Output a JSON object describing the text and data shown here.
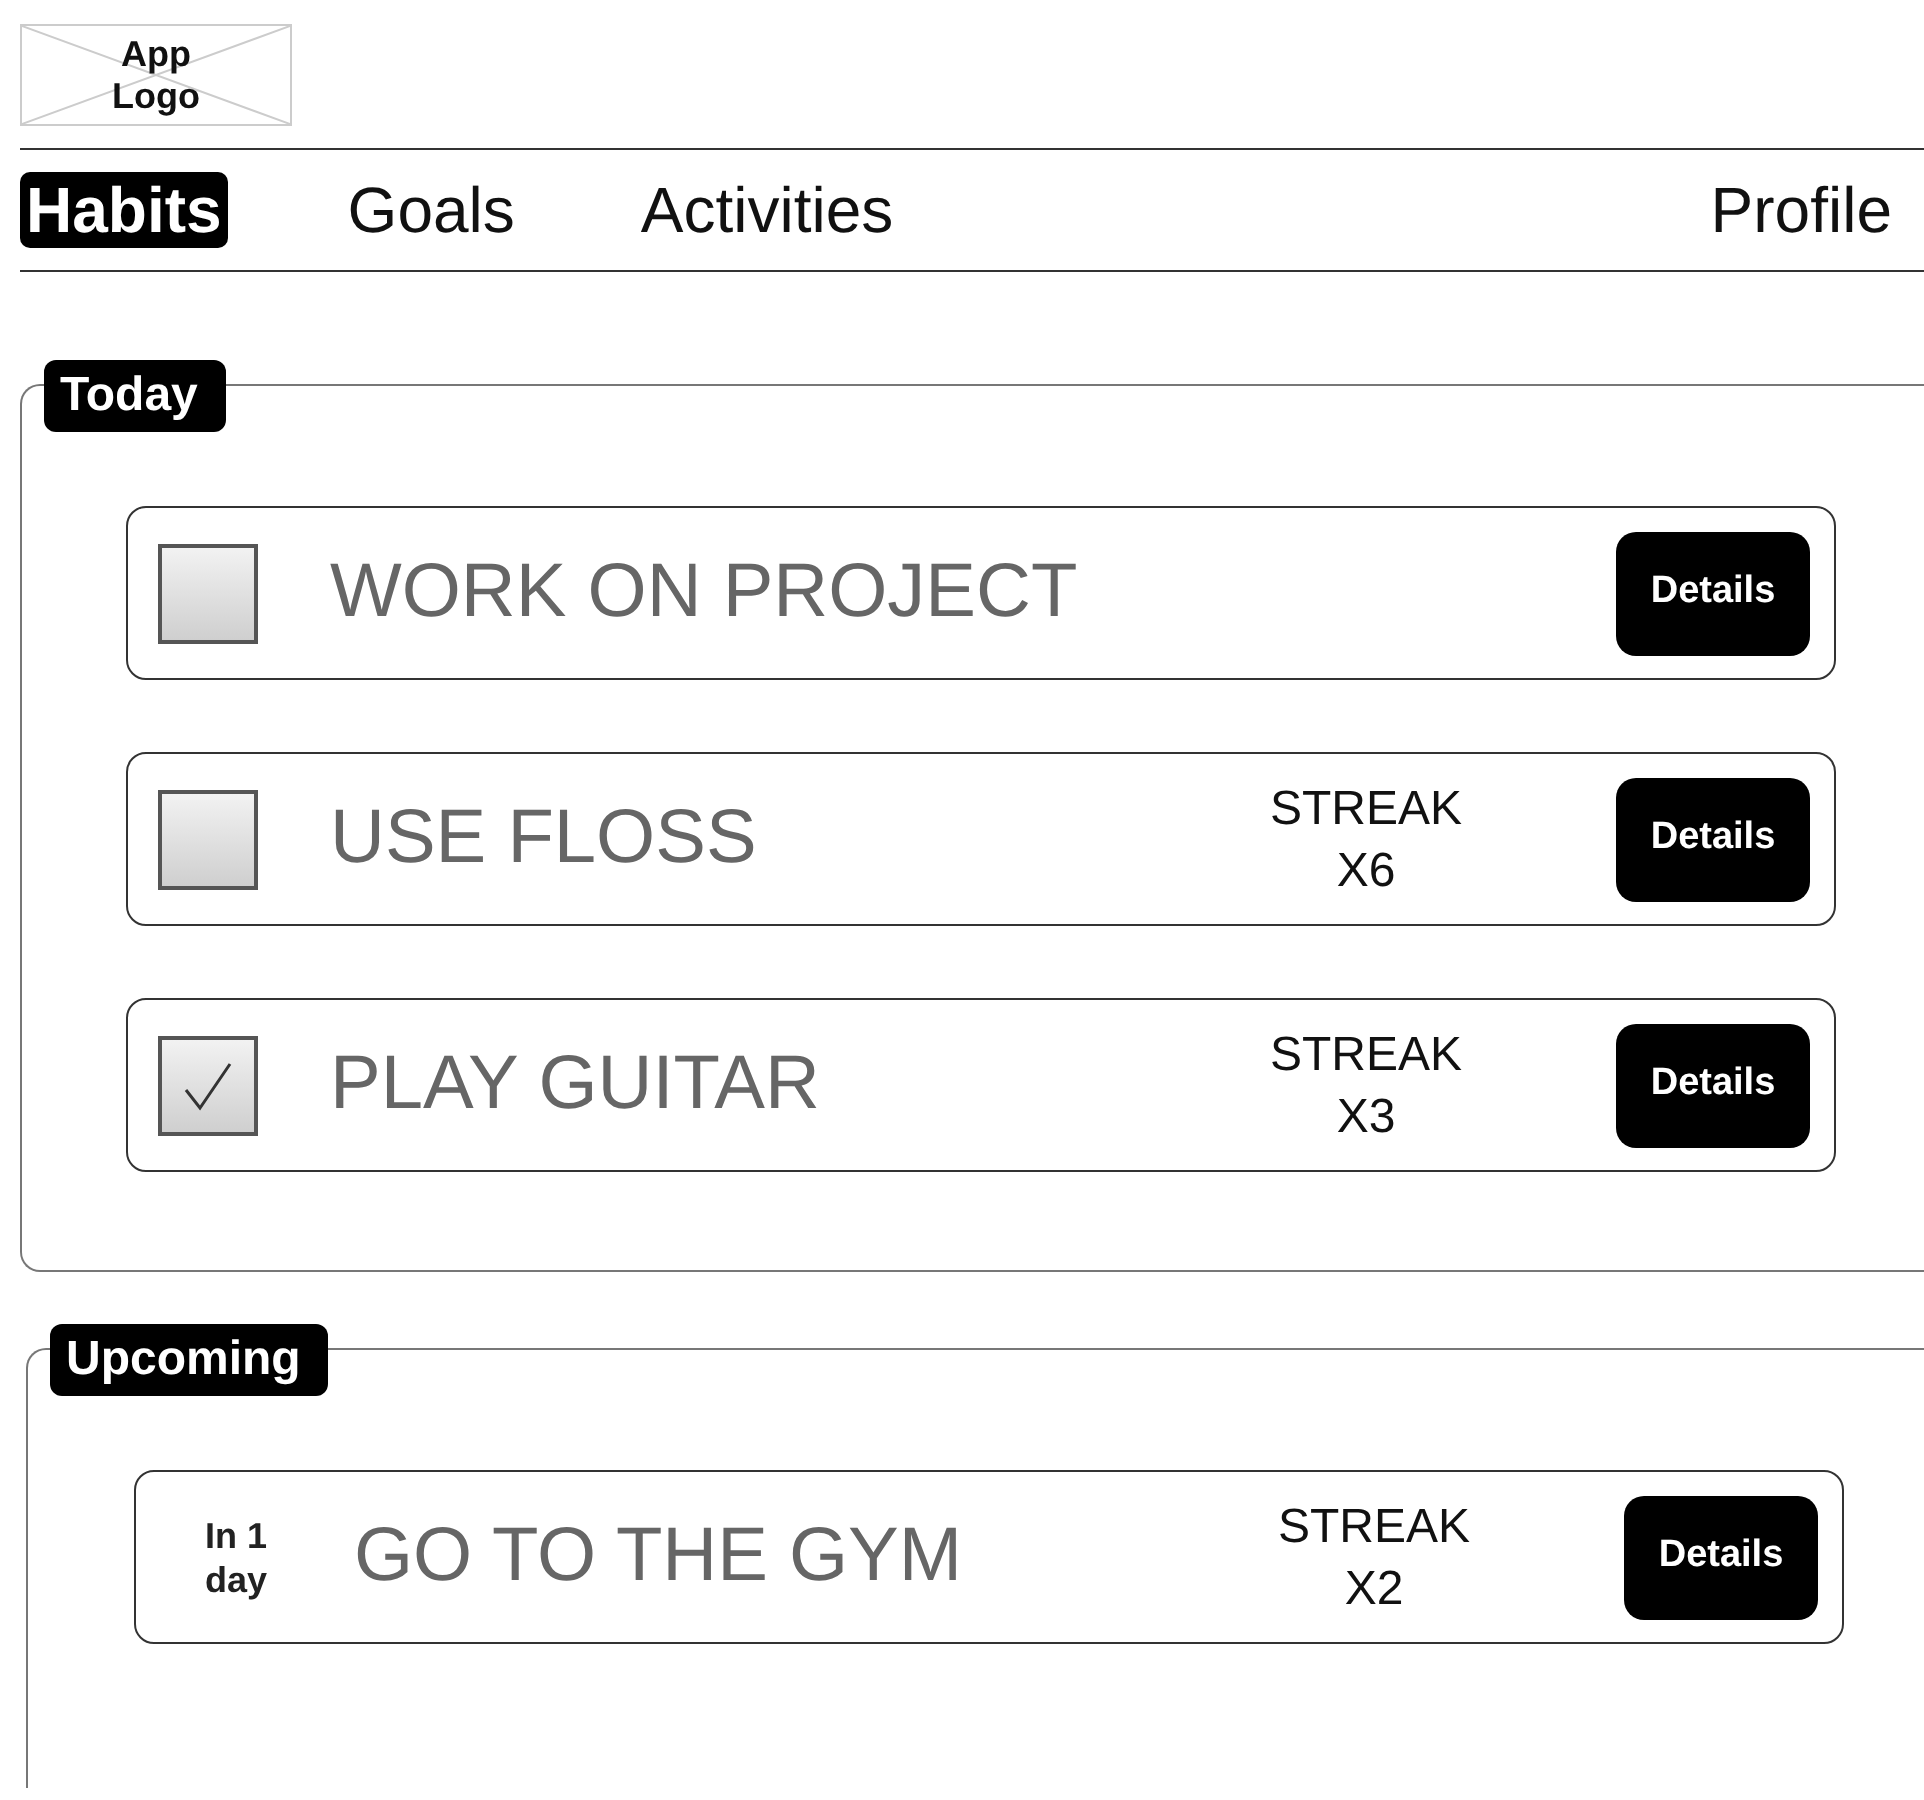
{
  "logo": {
    "text": "App Logo"
  },
  "nav": {
    "tabs": [
      {
        "label": "Habits",
        "selected": true
      },
      {
        "label": "Goals",
        "selected": false
      },
      {
        "label": "Activities",
        "selected": false
      }
    ],
    "profile": "Profile"
  },
  "sections": [
    {
      "title": "Today",
      "items": [
        {
          "kind": "checkbox",
          "checked": false,
          "title": "WORK ON PROJECT",
          "button": "Details"
        },
        {
          "kind": "checkbox",
          "checked": false,
          "title": "USE FLOSS",
          "streak": [
            "STREAK",
            "X6"
          ],
          "button": "Details"
        },
        {
          "kind": "checkbox",
          "checked": true,
          "title": "PLAY GUITAR",
          "streak": [
            "STREAK",
            "X3"
          ],
          "button": "Details"
        }
      ]
    },
    {
      "title": "Upcoming",
      "items": [
        {
          "kind": "upcoming",
          "due": "In 1 day",
          "title": "GO TO THE GYM",
          "streak": [
            "STREAK",
            "X2"
          ],
          "button": "Details"
        }
      ]
    }
  ]
}
